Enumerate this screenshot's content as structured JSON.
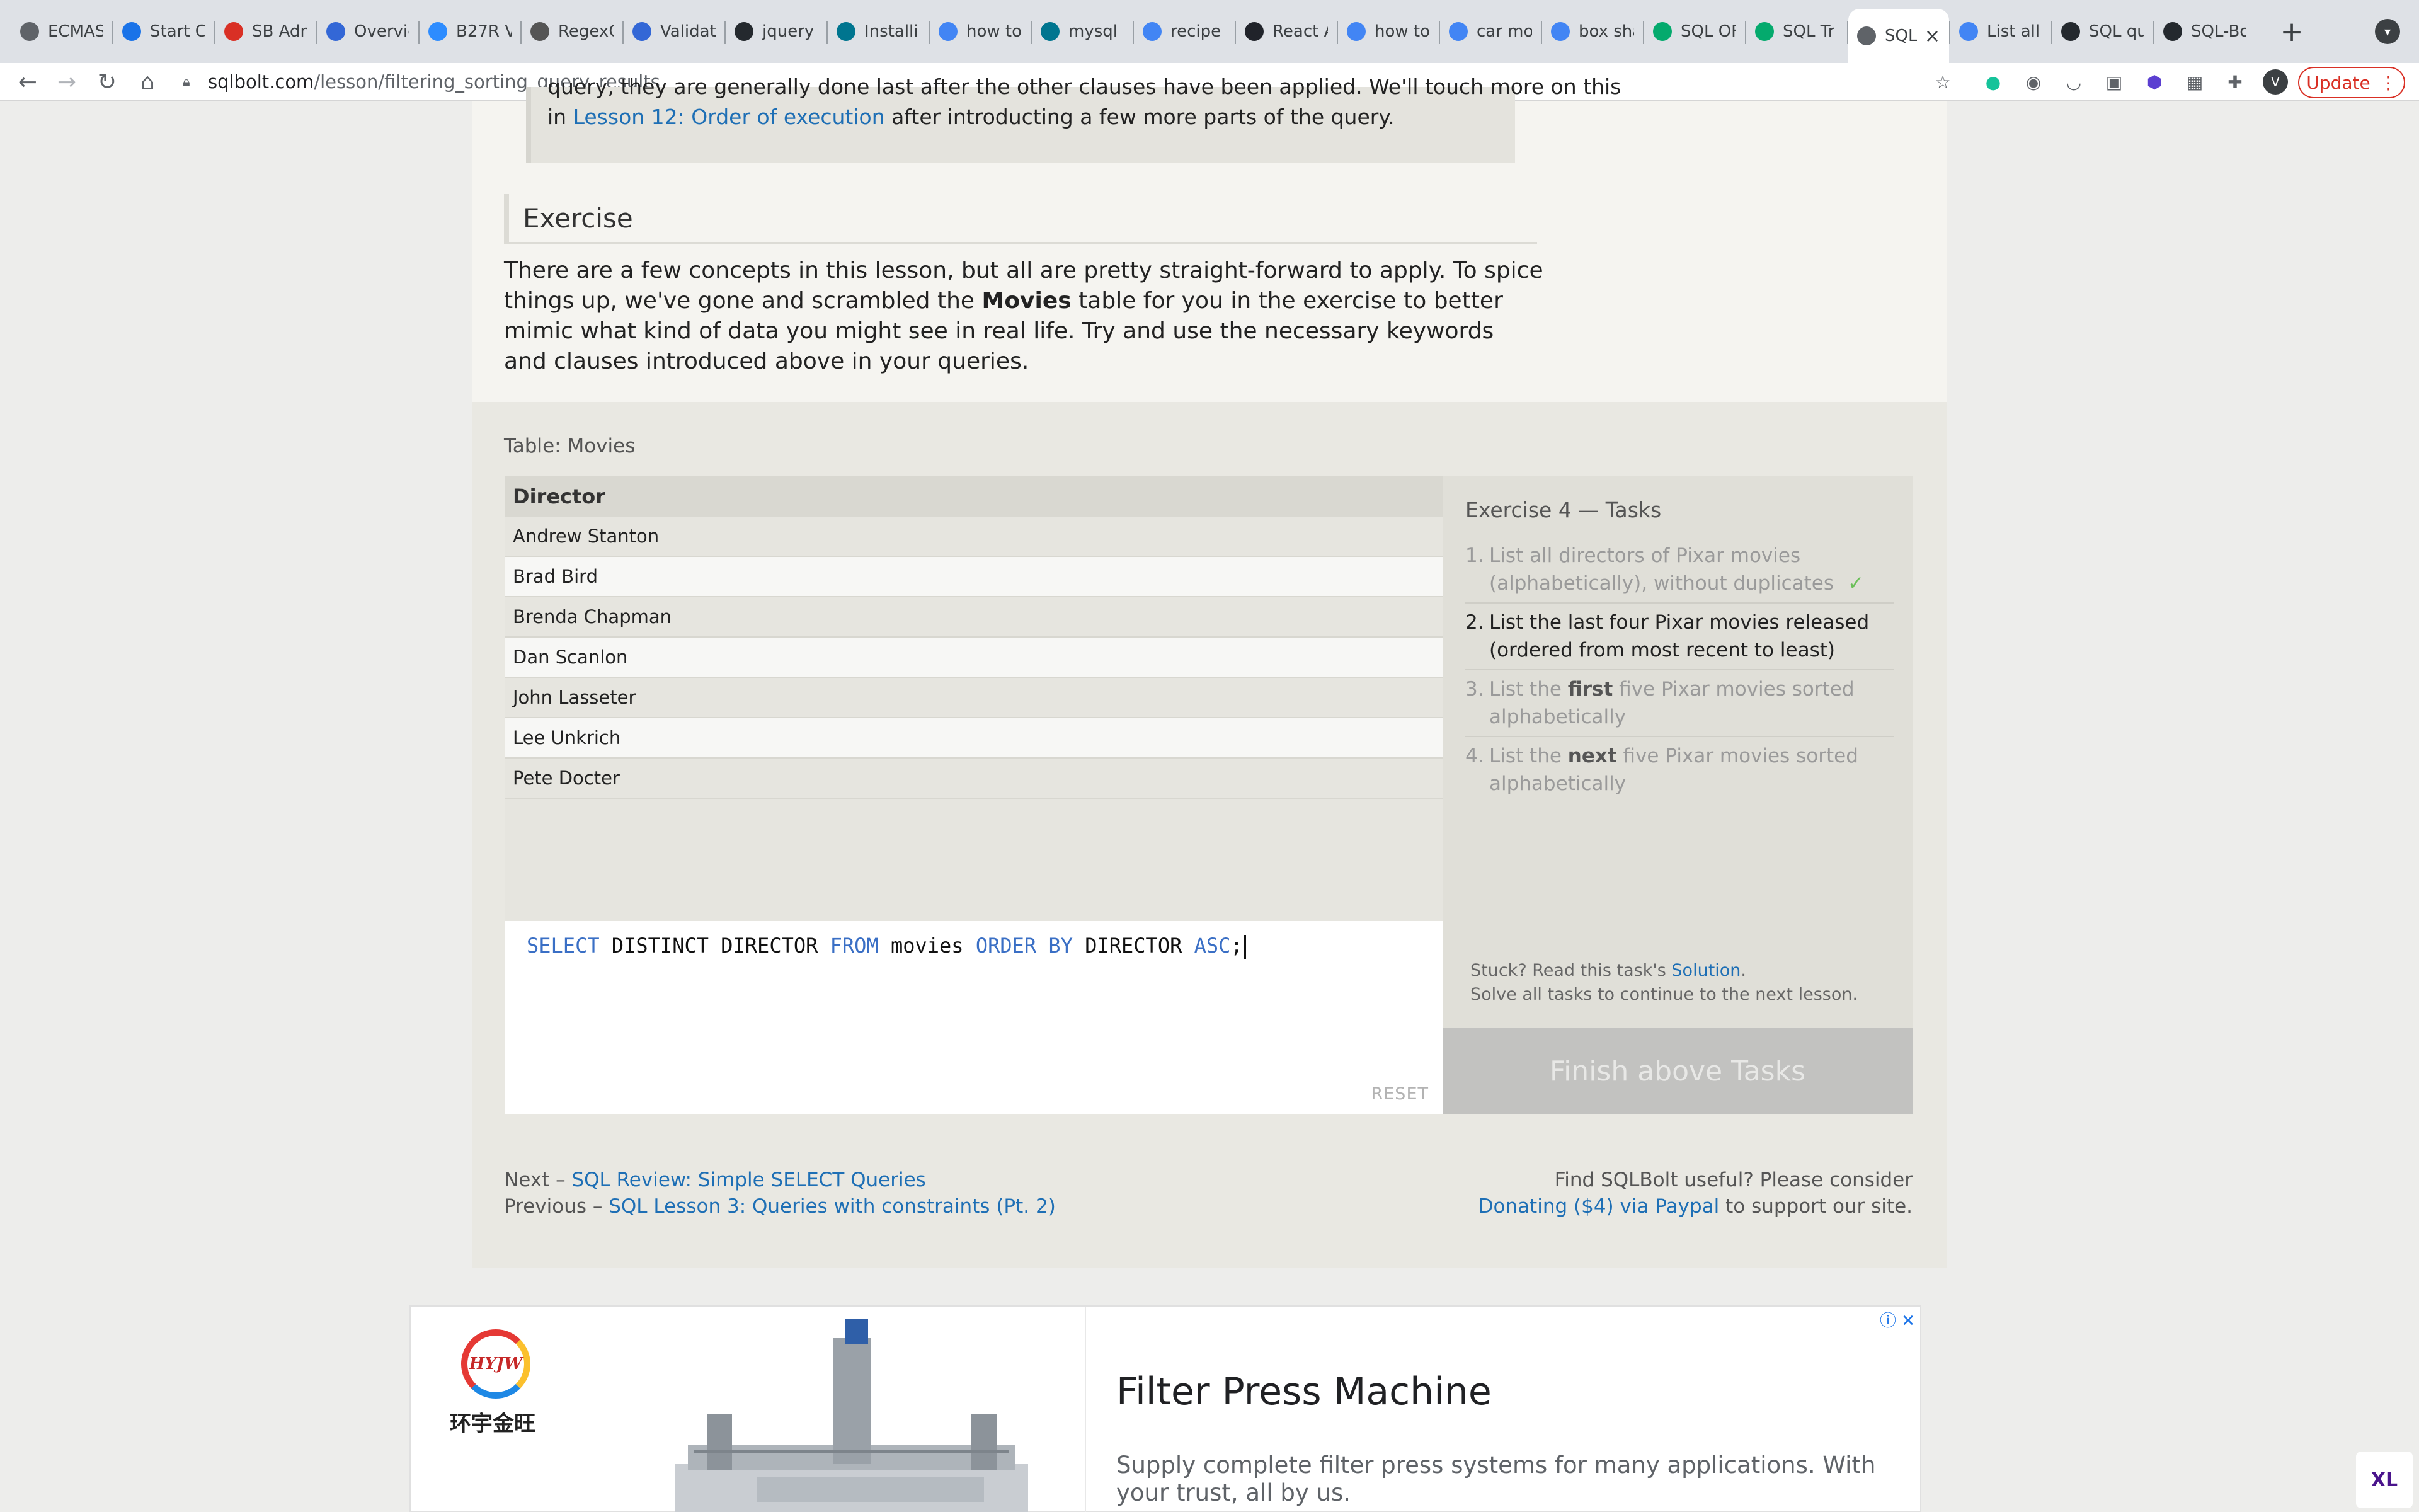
{
  "browser": {
    "tabs": [
      {
        "label": "ECMAS",
        "icon": "gear-icon",
        "color": "#5f6368"
      },
      {
        "label": "Start C",
        "icon": "chat-icon",
        "color": "#1a73e8"
      },
      {
        "label": "SB Adm",
        "icon": "s-logo-icon",
        "color": "#d93025"
      },
      {
        "label": "Overvie",
        "icon": "shield-icon",
        "color": "#3367d6"
      },
      {
        "label": "B27R V",
        "icon": "zoom-icon",
        "color": "#2d8cff"
      },
      {
        "label": "RegexC",
        "icon": "regex-icon",
        "color": "#555555"
      },
      {
        "label": "Validat",
        "icon": "shield-icon",
        "color": "#3367d6"
      },
      {
        "label": "jquery",
        "icon": "github-icon",
        "color": "#24292e"
      },
      {
        "label": "Installi",
        "icon": "mysql-icon",
        "color": "#00758f"
      },
      {
        "label": "how to",
        "icon": "google-icon",
        "color": "#4285f4"
      },
      {
        "label": "mysql (",
        "icon": "mysql-icon",
        "color": "#00758f"
      },
      {
        "label": "recipe",
        "icon": "google-icon",
        "color": "#4285f4"
      },
      {
        "label": "React A",
        "icon": "react-icon",
        "color": "#20232a"
      },
      {
        "label": "how to",
        "icon": "google-icon",
        "color": "#4285f4"
      },
      {
        "label": "car mo",
        "icon": "google-icon",
        "color": "#4285f4"
      },
      {
        "label": "box sha",
        "icon": "google-icon",
        "color": "#4285f4"
      },
      {
        "label": "SQL OF",
        "icon": "w3-icon",
        "color": "#04aa6d"
      },
      {
        "label": "SQL Tr",
        "icon": "w3-icon",
        "color": "#04aa6d"
      },
      {
        "label": "SQL",
        "icon": "db-icon",
        "color": "#5f6368",
        "active": true
      },
      {
        "label": "List all",
        "icon": "google-icon",
        "color": "#4285f4"
      },
      {
        "label": "SQL qu",
        "icon": "github-icon",
        "color": "#24292e"
      },
      {
        "label": "SQL-Bo",
        "icon": "github-icon",
        "color": "#24292e"
      }
    ],
    "url_host": "sqlbolt.com",
    "url_path": "/lesson/filtering_sorting_query_results",
    "update_label": "Update",
    "profile_initial": "V"
  },
  "lesson": {
    "note_line1": "query, they are generally done last after the other clauses have been applied. We'll touch more on this",
    "note_prefix": "in ",
    "note_link": "Lesson 12: Order of execution",
    "note_suffix": " after introducting a few more parts of the query.",
    "exercise_heading": "Exercise",
    "intro_part1": "There are a few concepts in this lesson, but all are pretty straight-forward to apply. To spice things up, we've gone and scrambled the ",
    "intro_bold": "Movies",
    "intro_part2": " table for you in the exercise to better mimic what kind of data you might see in real life. Try and use the necessary keywords and clauses introduced above in your queries."
  },
  "results": {
    "caption": "Table: Movies",
    "column": "Director",
    "rows": [
      "Andrew Stanton",
      "Brad Bird",
      "Brenda Chapman",
      "Dan Scanlon",
      "John Lasseter",
      "Lee Unkrich",
      "Pete Docter"
    ]
  },
  "editor": {
    "tokens": [
      "SELECT",
      " DISTINCT DIRECTOR ",
      "FROM",
      " movies ",
      "ORDER BY",
      " DIRECTOR ",
      "ASC",
      ";"
    ],
    "reset_label": "RESET"
  },
  "tasks": {
    "title": "Exercise 4 — Tasks",
    "items": [
      {
        "num": "1.",
        "text": "List all directors of Pixar movies (alphabetically), without duplicates",
        "state": "done"
      },
      {
        "num": "2.",
        "text": "List the last four Pixar movies released (ordered from most recent to least)",
        "state": "current"
      },
      {
        "num": "3.",
        "pre": "List the ",
        "em": "first",
        "post": " five Pixar movies sorted alphabetically",
        "state": "pending"
      },
      {
        "num": "4.",
        "pre": "List the ",
        "em": "next",
        "post": " five Pixar movies sorted alphabetically",
        "state": "pending"
      }
    ],
    "check_mark": "✓",
    "stuck_prefix": "Stuck? Read this task's ",
    "stuck_link": "Solution",
    "stuck_suffix": ".",
    "solve_all": "Solve all tasks to continue to the next lesson.",
    "finish_label": "Finish above Tasks"
  },
  "footer": {
    "next_label": "Next – ",
    "next_link": "SQL Review: Simple SELECT Queries",
    "prev_label": "Previous – ",
    "prev_link": "SQL Lesson 3: Queries with constraints (Pt. 2)",
    "support_line": "Find SQLBolt useful? Please consider",
    "donate_link": "Donating ($4) via Paypal",
    "donate_suffix": " to support our site."
  },
  "ad": {
    "logo_text": "HYJW",
    "logo_cn": "环宇金旺",
    "headline": "Filter Press Machine",
    "body": "Supply complete filter press systems for many applications. With your trust, all by us.",
    "info_icons": "ⓘ ✕",
    "badge": "XL"
  }
}
